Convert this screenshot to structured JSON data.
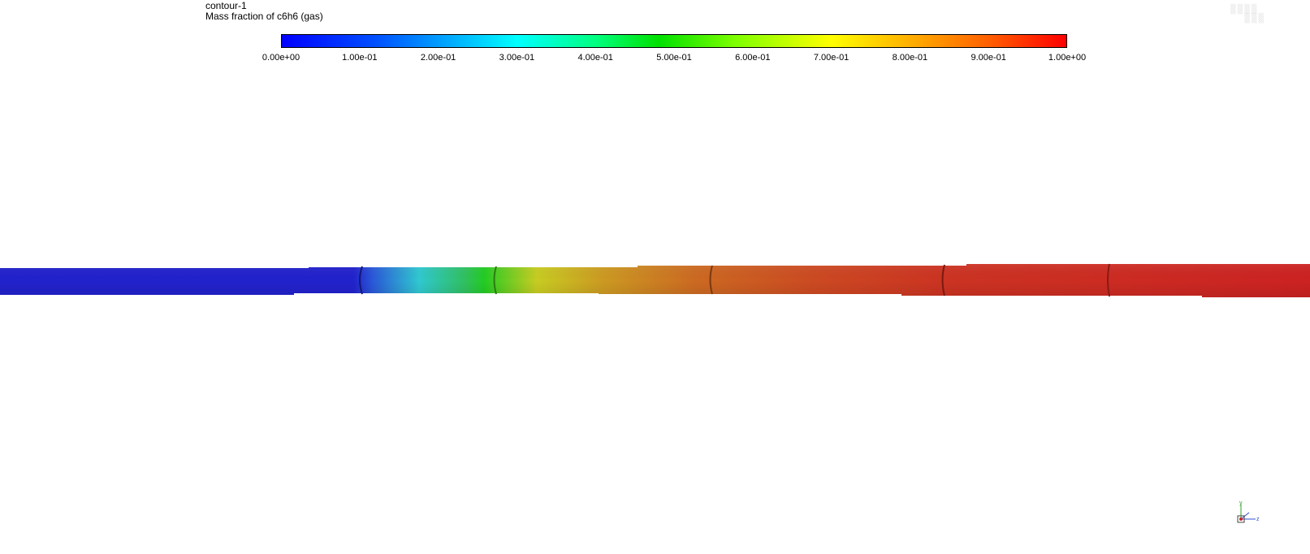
{
  "contour": {
    "name": "contour-1",
    "variable": "Mass fraction of c6h6 (gas)"
  },
  "colorbar": {
    "range": [
      0.0,
      1.0
    ],
    "tick_values": [
      0.0,
      0.1,
      0.2,
      0.3,
      0.4,
      0.5,
      0.6,
      0.7,
      0.8,
      0.9,
      1.0
    ],
    "tick_labels": [
      "0.00e+00",
      "1.00e-01",
      "2.00e-01",
      "3.00e-01",
      "4.00e-01",
      "5.00e-01",
      "6.00e-01",
      "7.00e-01",
      "8.00e-01",
      "9.00e-01",
      "1.00e+00"
    ],
    "colormap": [
      "#0000ff",
      "#00ffff",
      "#00e000",
      "#ffff00",
      "#ff0000"
    ]
  },
  "pipe_colors": {
    "inlet": "#2222cc",
    "green_zone": "#22cc22",
    "yellow_zone": "#cccc22",
    "orange_zone": "#cc7722",
    "outlet": "#cc2222"
  },
  "axes": {
    "labels": [
      "y",
      "z"
    ]
  }
}
